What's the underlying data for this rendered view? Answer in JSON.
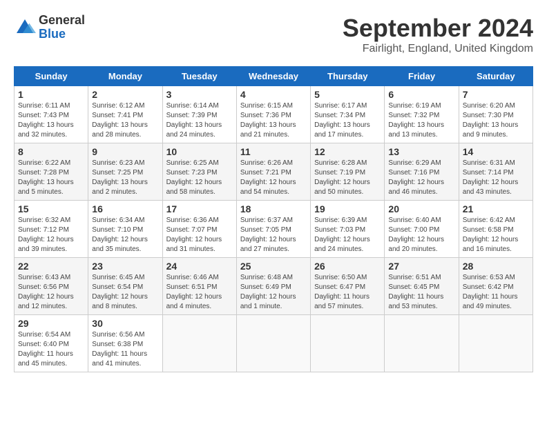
{
  "logo": {
    "general": "General",
    "blue": "Blue"
  },
  "title": "September 2024",
  "subtitle": "Fairlight, England, United Kingdom",
  "headers": [
    "Sunday",
    "Monday",
    "Tuesday",
    "Wednesday",
    "Thursday",
    "Friday",
    "Saturday"
  ],
  "weeks": [
    [
      {
        "day": "1",
        "info": "Sunrise: 6:11 AM\nSunset: 7:43 PM\nDaylight: 13 hours\nand 32 minutes."
      },
      {
        "day": "2",
        "info": "Sunrise: 6:12 AM\nSunset: 7:41 PM\nDaylight: 13 hours\nand 28 minutes."
      },
      {
        "day": "3",
        "info": "Sunrise: 6:14 AM\nSunset: 7:39 PM\nDaylight: 13 hours\nand 24 minutes."
      },
      {
        "day": "4",
        "info": "Sunrise: 6:15 AM\nSunset: 7:36 PM\nDaylight: 13 hours\nand 21 minutes."
      },
      {
        "day": "5",
        "info": "Sunrise: 6:17 AM\nSunset: 7:34 PM\nDaylight: 13 hours\nand 17 minutes."
      },
      {
        "day": "6",
        "info": "Sunrise: 6:19 AM\nSunset: 7:32 PM\nDaylight: 13 hours\nand 13 minutes."
      },
      {
        "day": "7",
        "info": "Sunrise: 6:20 AM\nSunset: 7:30 PM\nDaylight: 13 hours\nand 9 minutes."
      }
    ],
    [
      {
        "day": "8",
        "info": "Sunrise: 6:22 AM\nSunset: 7:28 PM\nDaylight: 13 hours\nand 5 minutes."
      },
      {
        "day": "9",
        "info": "Sunrise: 6:23 AM\nSunset: 7:25 PM\nDaylight: 13 hours\nand 2 minutes."
      },
      {
        "day": "10",
        "info": "Sunrise: 6:25 AM\nSunset: 7:23 PM\nDaylight: 12 hours\nand 58 minutes."
      },
      {
        "day": "11",
        "info": "Sunrise: 6:26 AM\nSunset: 7:21 PM\nDaylight: 12 hours\nand 54 minutes."
      },
      {
        "day": "12",
        "info": "Sunrise: 6:28 AM\nSunset: 7:19 PM\nDaylight: 12 hours\nand 50 minutes."
      },
      {
        "day": "13",
        "info": "Sunrise: 6:29 AM\nSunset: 7:16 PM\nDaylight: 12 hours\nand 46 minutes."
      },
      {
        "day": "14",
        "info": "Sunrise: 6:31 AM\nSunset: 7:14 PM\nDaylight: 12 hours\nand 43 minutes."
      }
    ],
    [
      {
        "day": "15",
        "info": "Sunrise: 6:32 AM\nSunset: 7:12 PM\nDaylight: 12 hours\nand 39 minutes."
      },
      {
        "day": "16",
        "info": "Sunrise: 6:34 AM\nSunset: 7:10 PM\nDaylight: 12 hours\nand 35 minutes."
      },
      {
        "day": "17",
        "info": "Sunrise: 6:36 AM\nSunset: 7:07 PM\nDaylight: 12 hours\nand 31 minutes."
      },
      {
        "day": "18",
        "info": "Sunrise: 6:37 AM\nSunset: 7:05 PM\nDaylight: 12 hours\nand 27 minutes."
      },
      {
        "day": "19",
        "info": "Sunrise: 6:39 AM\nSunset: 7:03 PM\nDaylight: 12 hours\nand 24 minutes."
      },
      {
        "day": "20",
        "info": "Sunrise: 6:40 AM\nSunset: 7:00 PM\nDaylight: 12 hours\nand 20 minutes."
      },
      {
        "day": "21",
        "info": "Sunrise: 6:42 AM\nSunset: 6:58 PM\nDaylight: 12 hours\nand 16 minutes."
      }
    ],
    [
      {
        "day": "22",
        "info": "Sunrise: 6:43 AM\nSunset: 6:56 PM\nDaylight: 12 hours\nand 12 minutes."
      },
      {
        "day": "23",
        "info": "Sunrise: 6:45 AM\nSunset: 6:54 PM\nDaylight: 12 hours\nand 8 minutes."
      },
      {
        "day": "24",
        "info": "Sunrise: 6:46 AM\nSunset: 6:51 PM\nDaylight: 12 hours\nand 4 minutes."
      },
      {
        "day": "25",
        "info": "Sunrise: 6:48 AM\nSunset: 6:49 PM\nDaylight: 12 hours\nand 1 minute."
      },
      {
        "day": "26",
        "info": "Sunrise: 6:50 AM\nSunset: 6:47 PM\nDaylight: 11 hours\nand 57 minutes."
      },
      {
        "day": "27",
        "info": "Sunrise: 6:51 AM\nSunset: 6:45 PM\nDaylight: 11 hours\nand 53 minutes."
      },
      {
        "day": "28",
        "info": "Sunrise: 6:53 AM\nSunset: 6:42 PM\nDaylight: 11 hours\nand 49 minutes."
      }
    ],
    [
      {
        "day": "29",
        "info": "Sunrise: 6:54 AM\nSunset: 6:40 PM\nDaylight: 11 hours\nand 45 minutes."
      },
      {
        "day": "30",
        "info": "Sunrise: 6:56 AM\nSunset: 6:38 PM\nDaylight: 11 hours\nand 41 minutes."
      },
      {
        "day": "",
        "info": ""
      },
      {
        "day": "",
        "info": ""
      },
      {
        "day": "",
        "info": ""
      },
      {
        "day": "",
        "info": ""
      },
      {
        "day": "",
        "info": ""
      }
    ]
  ]
}
